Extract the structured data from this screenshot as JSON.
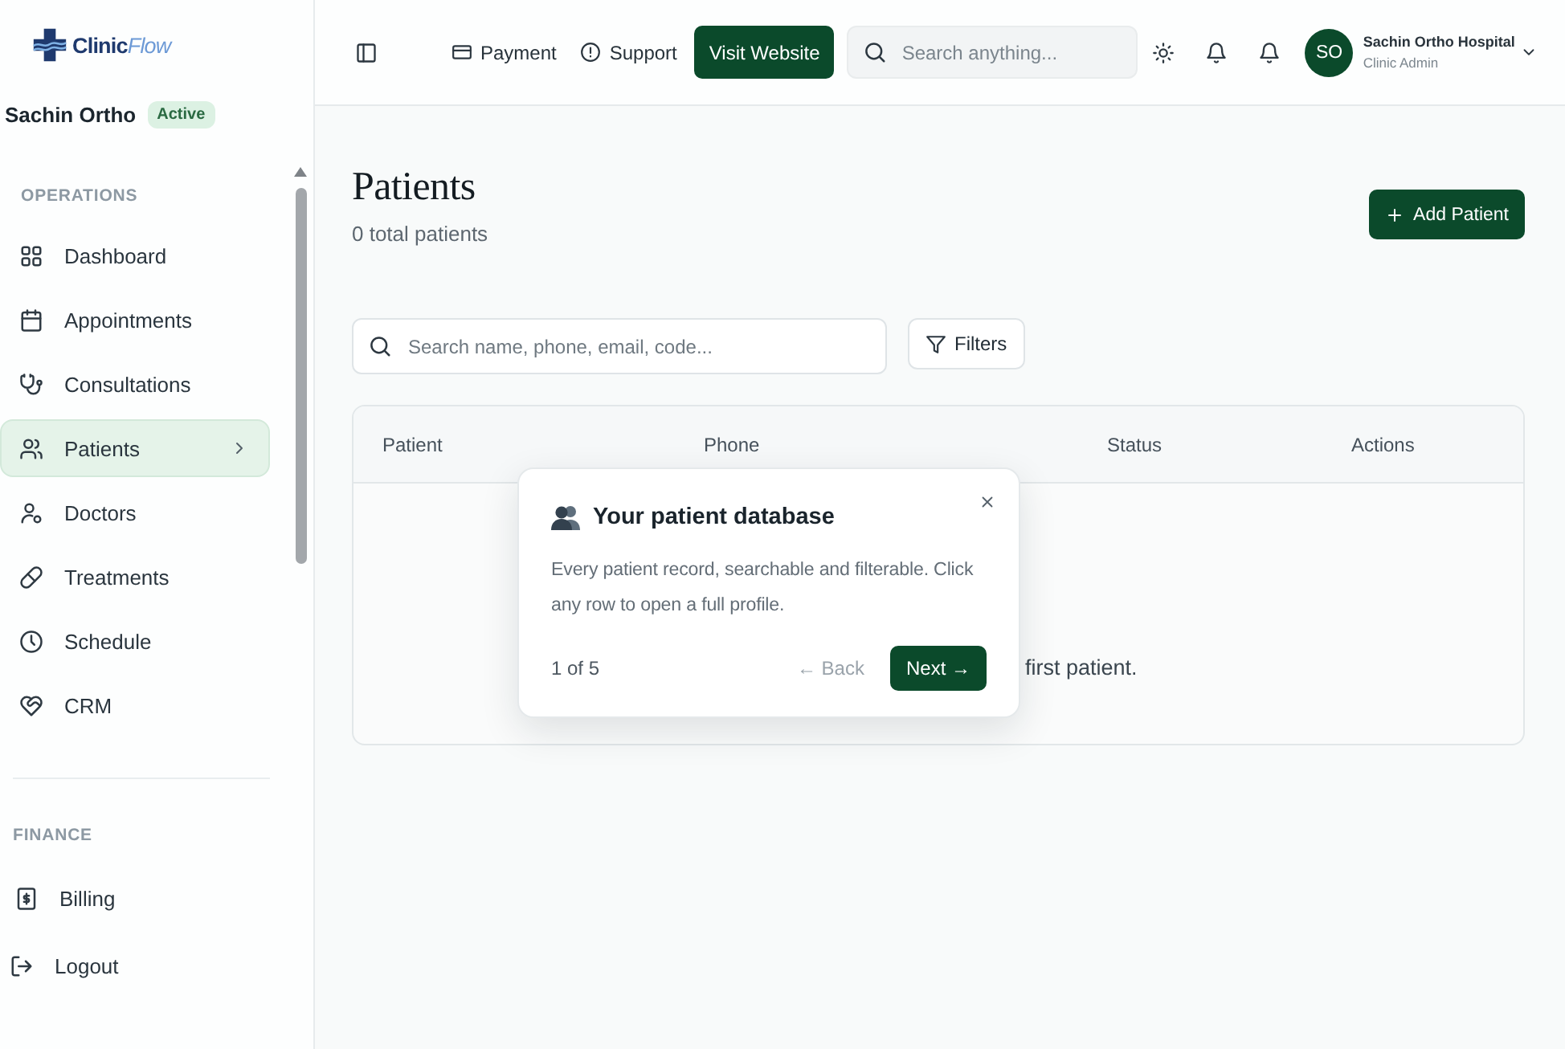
{
  "logo": {
    "text": "Clinic",
    "accent": "Flow"
  },
  "clinic": {
    "name": "Sachin Ortho",
    "status": "Active"
  },
  "sidebar": {
    "sections": [
      {
        "heading": "OPERATIONS",
        "items": [
          {
            "label": "Dashboard",
            "selected": false
          },
          {
            "label": "Appointments",
            "selected": false
          },
          {
            "label": "Consultations",
            "selected": false
          },
          {
            "label": "Patients",
            "selected": true
          },
          {
            "label": "Doctors",
            "selected": false
          },
          {
            "label": "Treatments",
            "selected": false
          },
          {
            "label": "Schedule",
            "selected": false
          },
          {
            "label": "CRM",
            "selected": false
          }
        ]
      },
      {
        "heading": "FINANCE",
        "items": [
          {
            "label": "Billing",
            "selected": false
          }
        ]
      }
    ],
    "logout": "Logout"
  },
  "topbar": {
    "links": [
      "Payment",
      "Support"
    ],
    "visit_button": "Visit Website",
    "search": {
      "placeholder": "Search anything..."
    },
    "user": {
      "initials": "SO",
      "name": "Sachin Ortho Hospital",
      "role": "Clinic Admin"
    }
  },
  "page": {
    "title": "Patients",
    "subtitle": "0 total patients",
    "add_button": "Add Patient",
    "search": {
      "placeholder": "Search name, phone, email, code..."
    },
    "filters_button": "Filters"
  },
  "table": {
    "columns": [
      "Patient",
      "Phone",
      "Status",
      "Actions"
    ],
    "empty_message": "first patient."
  },
  "tour": {
    "title": "Your patient database",
    "body": "Every patient record, searchable and filterable. Click any row to open a full profile.",
    "step": "1 of 5",
    "back": "← Back",
    "next": "Next →"
  }
}
